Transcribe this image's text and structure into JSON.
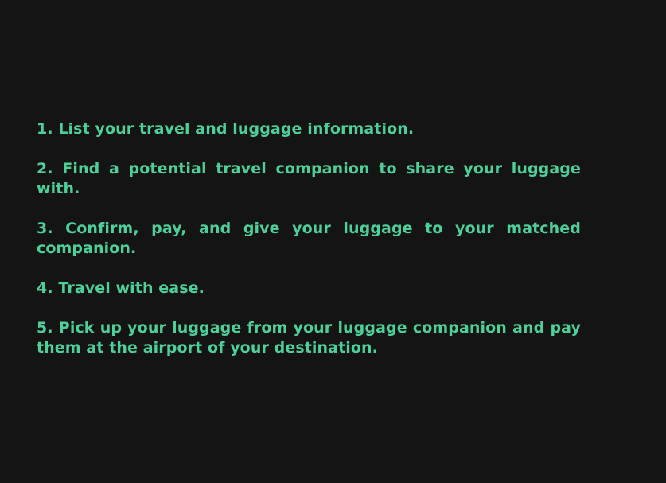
{
  "steps": [
    "1. List your travel and luggage information.",
    "2. Find a potential travel companion to share your luggage with.",
    "3. Confirm, pay, and give your luggage to your matched companion.",
    "4. Travel with ease.",
    "5. Pick up your luggage from your luggage companion and pay them at the airport of your destination."
  ],
  "colors": {
    "background": "#141414",
    "text": "#4ccf99"
  }
}
